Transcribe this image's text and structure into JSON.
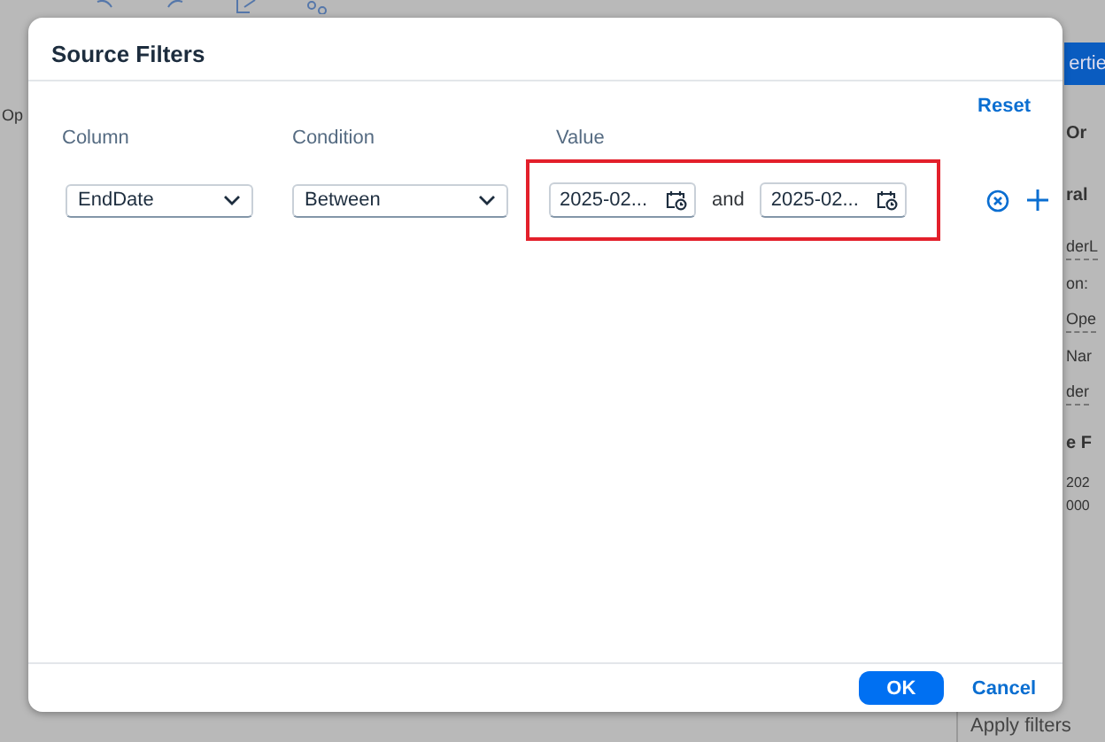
{
  "background": {
    "toolbar_text": "Op",
    "properties_tab": "ertie",
    "panel_items": [
      {
        "kind": "heading",
        "text": "Or"
      },
      {
        "kind": "heading",
        "text": "ral"
      },
      {
        "kind": "field",
        "text": "derL"
      },
      {
        "kind": "label",
        "text": "on:"
      },
      {
        "kind": "field",
        "text": "Ope"
      },
      {
        "kind": "label",
        "text": "Nar"
      },
      {
        "kind": "field",
        "text": "der"
      },
      {
        "kind": "heading",
        "text": "e F"
      },
      {
        "kind": "value",
        "text": "202"
      },
      {
        "kind": "value",
        "text": "000"
      }
    ],
    "footer_text": "Apply filters"
  },
  "dialog": {
    "title": "Source Filters",
    "reset": "Reset",
    "columns": [
      "Column",
      "Condition",
      "Value"
    ],
    "filter": {
      "column": "EndDate",
      "condition": "Between",
      "values": [
        "2025-02...",
        "2025-02..."
      ],
      "joiner": "and",
      "highlighted": true
    },
    "buttons": [
      {
        "label": "OK",
        "kind": "primary"
      },
      {
        "label": "Cancel",
        "kind": "link"
      }
    ]
  }
}
